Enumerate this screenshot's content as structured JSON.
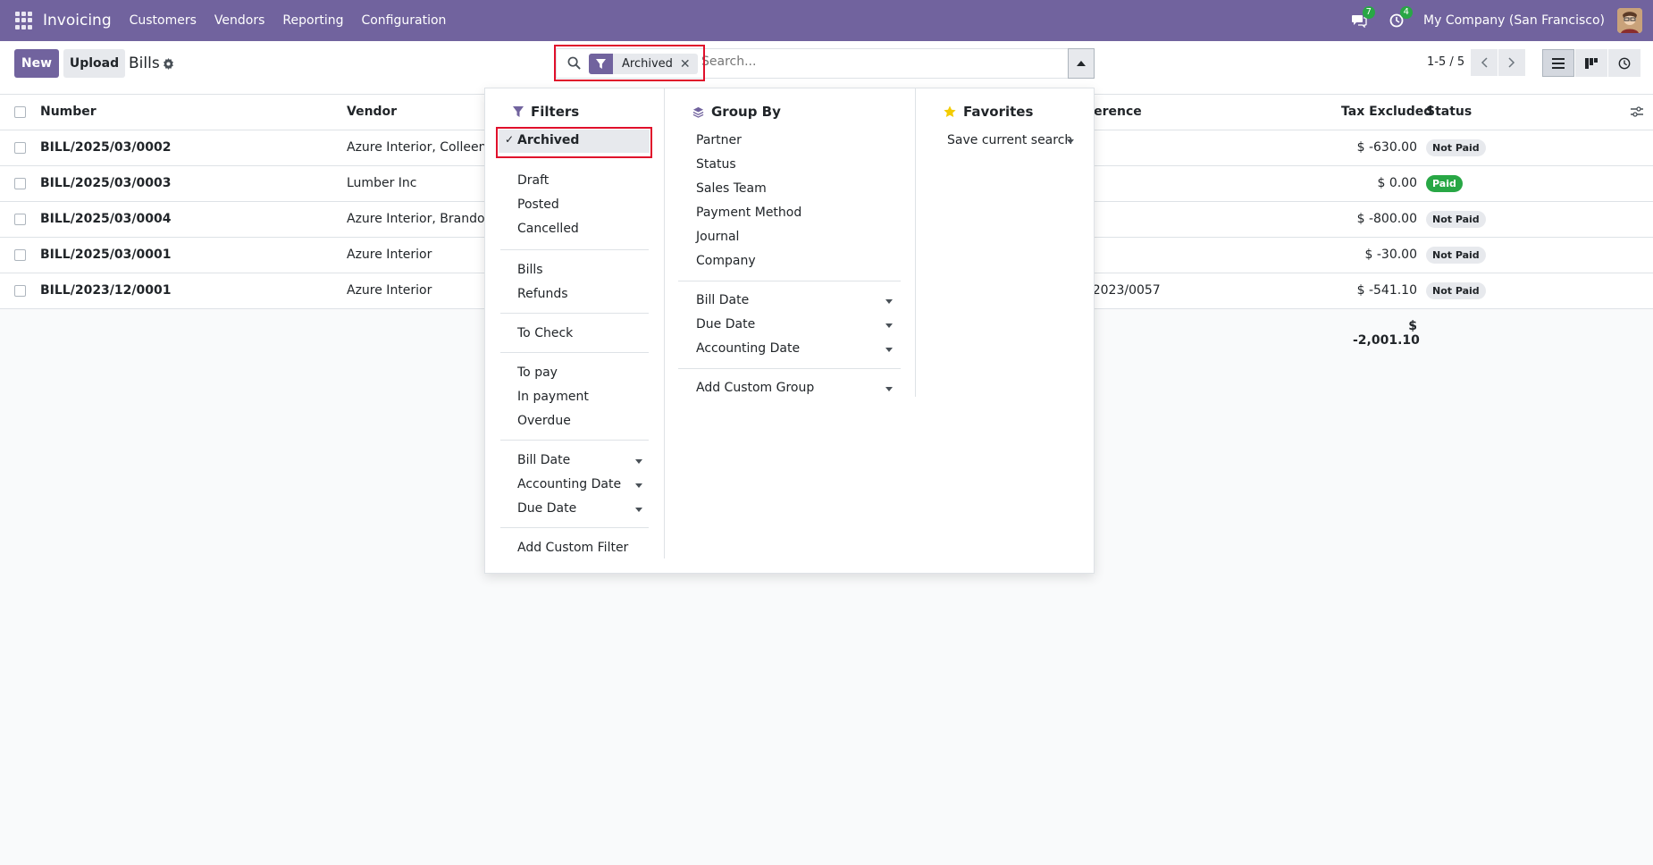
{
  "navbar": {
    "brand": "Invoicing",
    "menu": [
      "Customers",
      "Vendors",
      "Reporting",
      "Configuration"
    ],
    "messages_badge": "7",
    "activities_badge": "4",
    "company": "My Company (San Francisco)"
  },
  "control": {
    "new_label": "New",
    "upload_label": "Upload",
    "title": "Bills",
    "facet_label": "Archived",
    "search_placeholder": "Search...",
    "pager": "1-5 / 5"
  },
  "table": {
    "headers": {
      "number": "Number",
      "vendor": "Vendor",
      "reference": "ference",
      "tax_excluded": "Tax Excluded",
      "status": "Status"
    },
    "rows": [
      {
        "number": "BILL/2025/03/0002",
        "vendor": "Azure Interior, Colleen D",
        "reference": "",
        "amount": "$ -630.00",
        "status": "Not Paid"
      },
      {
        "number": "BILL/2025/03/0003",
        "vendor": "Lumber Inc",
        "reference": "",
        "amount": "$ 0.00",
        "status": "Paid"
      },
      {
        "number": "BILL/2025/03/0004",
        "vendor": "Azure Interior, Brandon I",
        "reference": "",
        "amount": "$ -800.00",
        "status": "Not Paid"
      },
      {
        "number": "BILL/2025/03/0001",
        "vendor": "Azure Interior",
        "reference": "",
        "amount": "$ -30.00",
        "status": "Not Paid"
      },
      {
        "number": "BILL/2023/12/0001",
        "vendor": "Azure Interior",
        "reference": "/2023/0057",
        "amount": "$ -541.10",
        "status": "Not Paid"
      }
    ],
    "total": "$ -2,001.10"
  },
  "filters": {
    "title": "Filters",
    "archived": "Archived",
    "draft": "Draft",
    "posted": "Posted",
    "cancelled": "Cancelled",
    "bills": "Bills",
    "refunds": "Refunds",
    "to_check": "To Check",
    "to_pay": "To pay",
    "in_payment": "In payment",
    "overdue": "Overdue",
    "bill_date": "Bill Date",
    "accounting_date": "Accounting Date",
    "due_date": "Due Date",
    "add_custom": "Add Custom Filter"
  },
  "groupby": {
    "title": "Group By",
    "partner": "Partner",
    "status": "Status",
    "sales_team": "Sales Team",
    "payment_method": "Payment Method",
    "journal": "Journal",
    "company": "Company",
    "bill_date": "Bill Date",
    "due_date": "Due Date",
    "accounting_date": "Accounting Date",
    "add_custom": "Add Custom Group"
  },
  "favorites": {
    "title": "Favorites",
    "save": "Save current search"
  },
  "colors": {
    "brand": "#71639e",
    "paid": "#28a745",
    "highlight": "#e0102b"
  }
}
